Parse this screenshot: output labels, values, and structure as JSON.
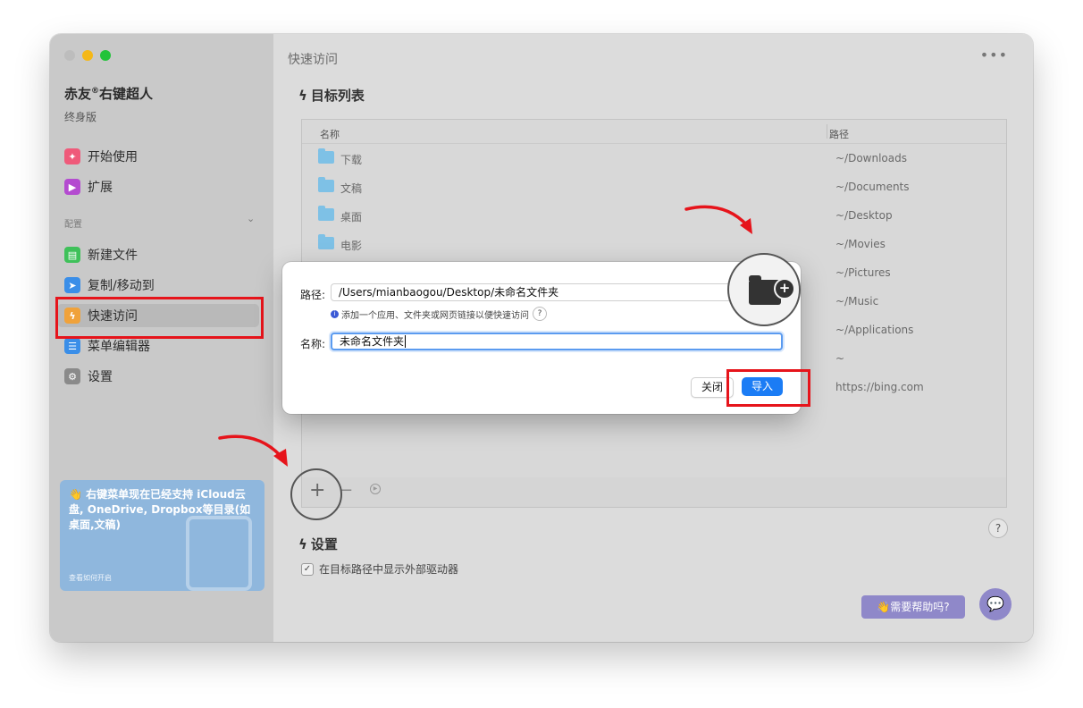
{
  "sidebar": {
    "app_name": "赤友",
    "app_reg": "®",
    "app_name_suffix": "右键超人",
    "edition": "终身版",
    "top_items": [
      {
        "label": "开始使用",
        "icon": "lightbulb-icon",
        "color": "#ef5a7a"
      },
      {
        "label": "扩展",
        "icon": "extension-icon",
        "color": "#b44bd0"
      }
    ],
    "section_label": "配置",
    "config_items": [
      {
        "label": "新建文件",
        "icon": "new-file-icon",
        "color": "#3fc15a"
      },
      {
        "label": "复制/移动到",
        "icon": "send-icon",
        "color": "#3a8ee8"
      },
      {
        "label": "快速访问",
        "icon": "bolt-icon",
        "color": "#f0a23a"
      },
      {
        "label": "菜单编辑器",
        "icon": "list-icon",
        "color": "#3a8ee8"
      },
      {
        "label": "设置",
        "icon": "gear-icon",
        "color": "#8a8a8a"
      }
    ],
    "promo": {
      "text": "👋 右键菜单现在已经支持 iCloud云盘, OneDrive, Dropbox等目录(如桌面,文稿)",
      "link": "查看如何开启"
    }
  },
  "main": {
    "title": "快速访问",
    "target_section": "目标列表",
    "columns": {
      "name": "名称",
      "path": "路径"
    },
    "rows": [
      {
        "name": "下载",
        "path": "~/Downloads"
      },
      {
        "name": "文稿",
        "path": "~/Documents"
      },
      {
        "name": "桌面",
        "path": "~/Desktop"
      },
      {
        "name": "电影",
        "path": "~/Movies"
      },
      {
        "name": "",
        "path": "~/Pictures"
      },
      {
        "name": "",
        "path": "~/Music"
      },
      {
        "name": "",
        "path": "~/Applications"
      },
      {
        "name": "",
        "path": "~"
      },
      {
        "name": "",
        "path": "https://bing.com"
      }
    ],
    "settings_section": "设置",
    "setting_option": "在目标路径中显示外部驱动器",
    "help_button": "👋需要帮助吗?"
  },
  "dialog": {
    "path_label": "路径:",
    "path_value": "/Users/mianbaogou/Desktop/未命名文件夹",
    "hint": "添加一个应用、文件夹或网页链接以便快速访问",
    "name_label": "名称:",
    "name_value": "未命名文件夹",
    "close_button": "关闭",
    "import_button": "导入"
  },
  "colors": {
    "accent_blue": "#1b7cf5",
    "annotation_red": "#e6141b",
    "help_purple": "#8f88c9",
    "promo_blue": "#8fb7dd"
  }
}
